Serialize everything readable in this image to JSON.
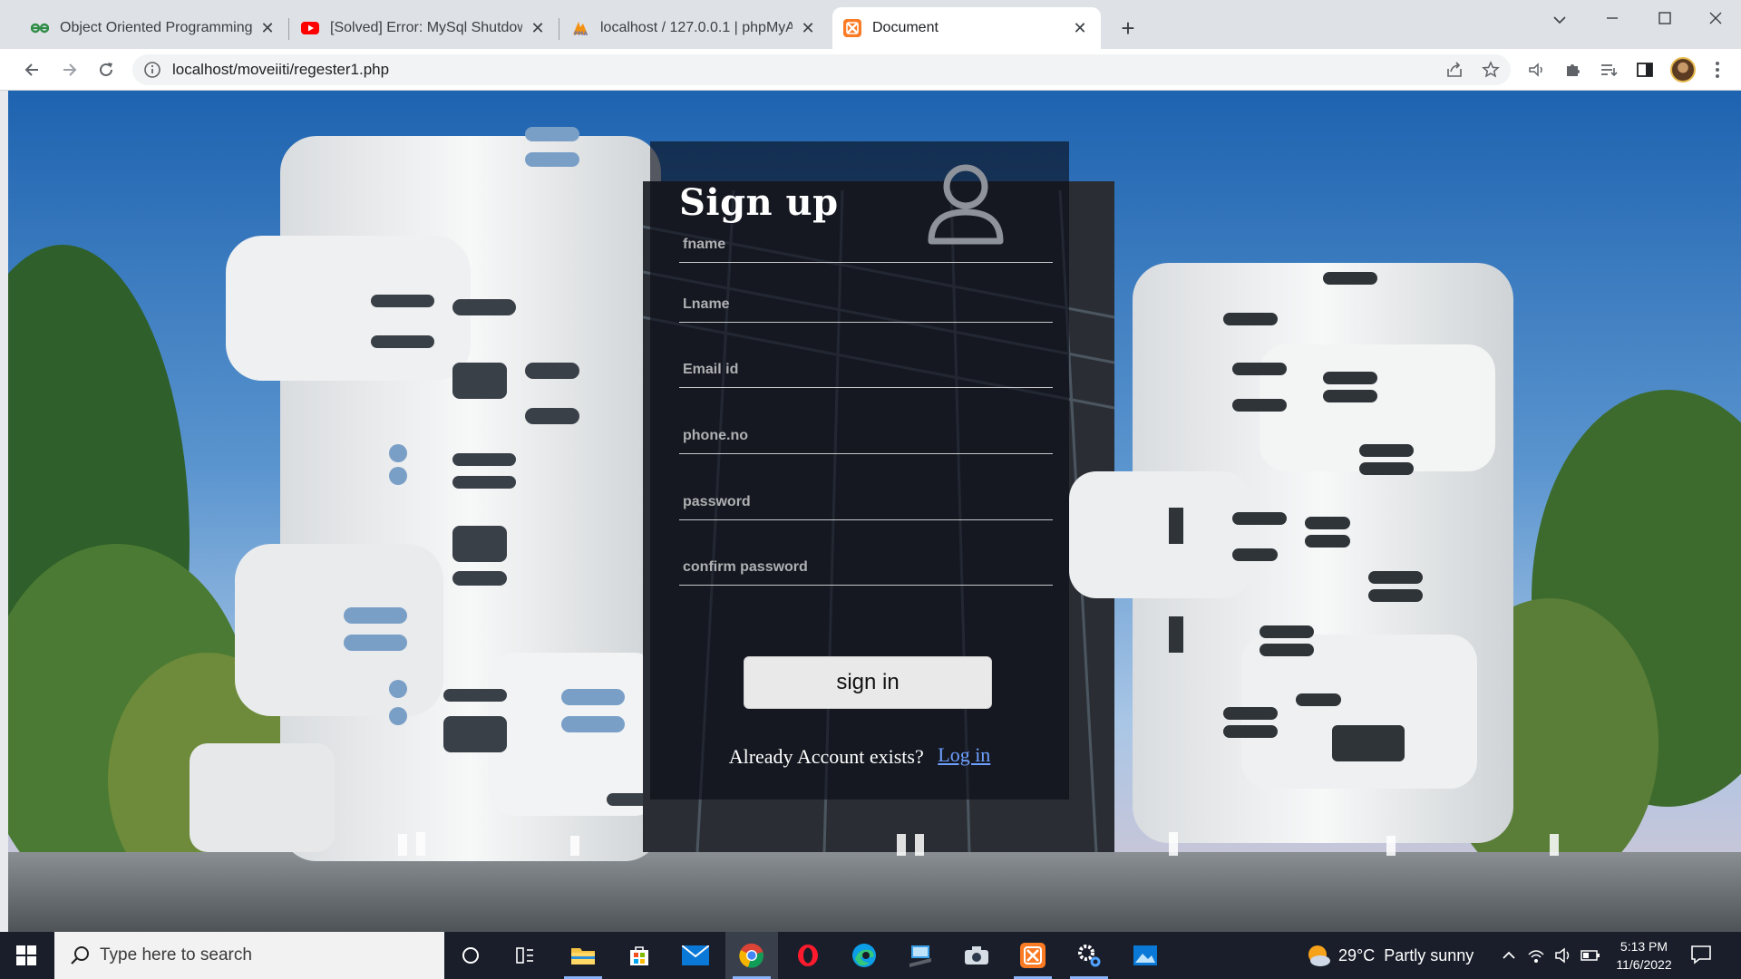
{
  "browser": {
    "tabs": [
      {
        "title": "Object Oriented Programming in",
        "icon": "gfg-icon",
        "active": false
      },
      {
        "title": "[Solved] Error: MySql Shutdown U",
        "icon": "youtube-icon",
        "active": false
      },
      {
        "title": "localhost / 127.0.0.1 | phpMyAdm",
        "icon": "phpmyadmin-icon",
        "active": false
      },
      {
        "title": "Document",
        "icon": "xampp-icon",
        "active": true
      }
    ],
    "url": "localhost/moveiiti/regester1.php"
  },
  "form": {
    "title": "Sign up",
    "fields": {
      "fname": "fname",
      "lname": "Lname",
      "email": "Email id",
      "phone": "phone.no",
      "password": "password",
      "confirm": "confirm password"
    },
    "submit_label": "sign in",
    "already_text": "Already Account exists?",
    "login_label": "Log in"
  },
  "taskbar": {
    "search_placeholder": "Type here to search",
    "weather_text": "29°C  Partly sunny",
    "time": "5:13 PM",
    "date": "11/6/2022",
    "apps": [
      "cortana-icon",
      "task-view-icon",
      "file-explorer-icon",
      "store-icon",
      "mail-icon",
      "chrome-icon",
      "opera-icon",
      "edge-icon",
      "network-app-icon",
      "camera-icon",
      "xampp-icon",
      "settings-icon",
      "photos-icon"
    ]
  },
  "colors": {
    "card_overlay": "#080c16",
    "link": "#6ea0ff",
    "taskbar": "#1a1e2a"
  }
}
